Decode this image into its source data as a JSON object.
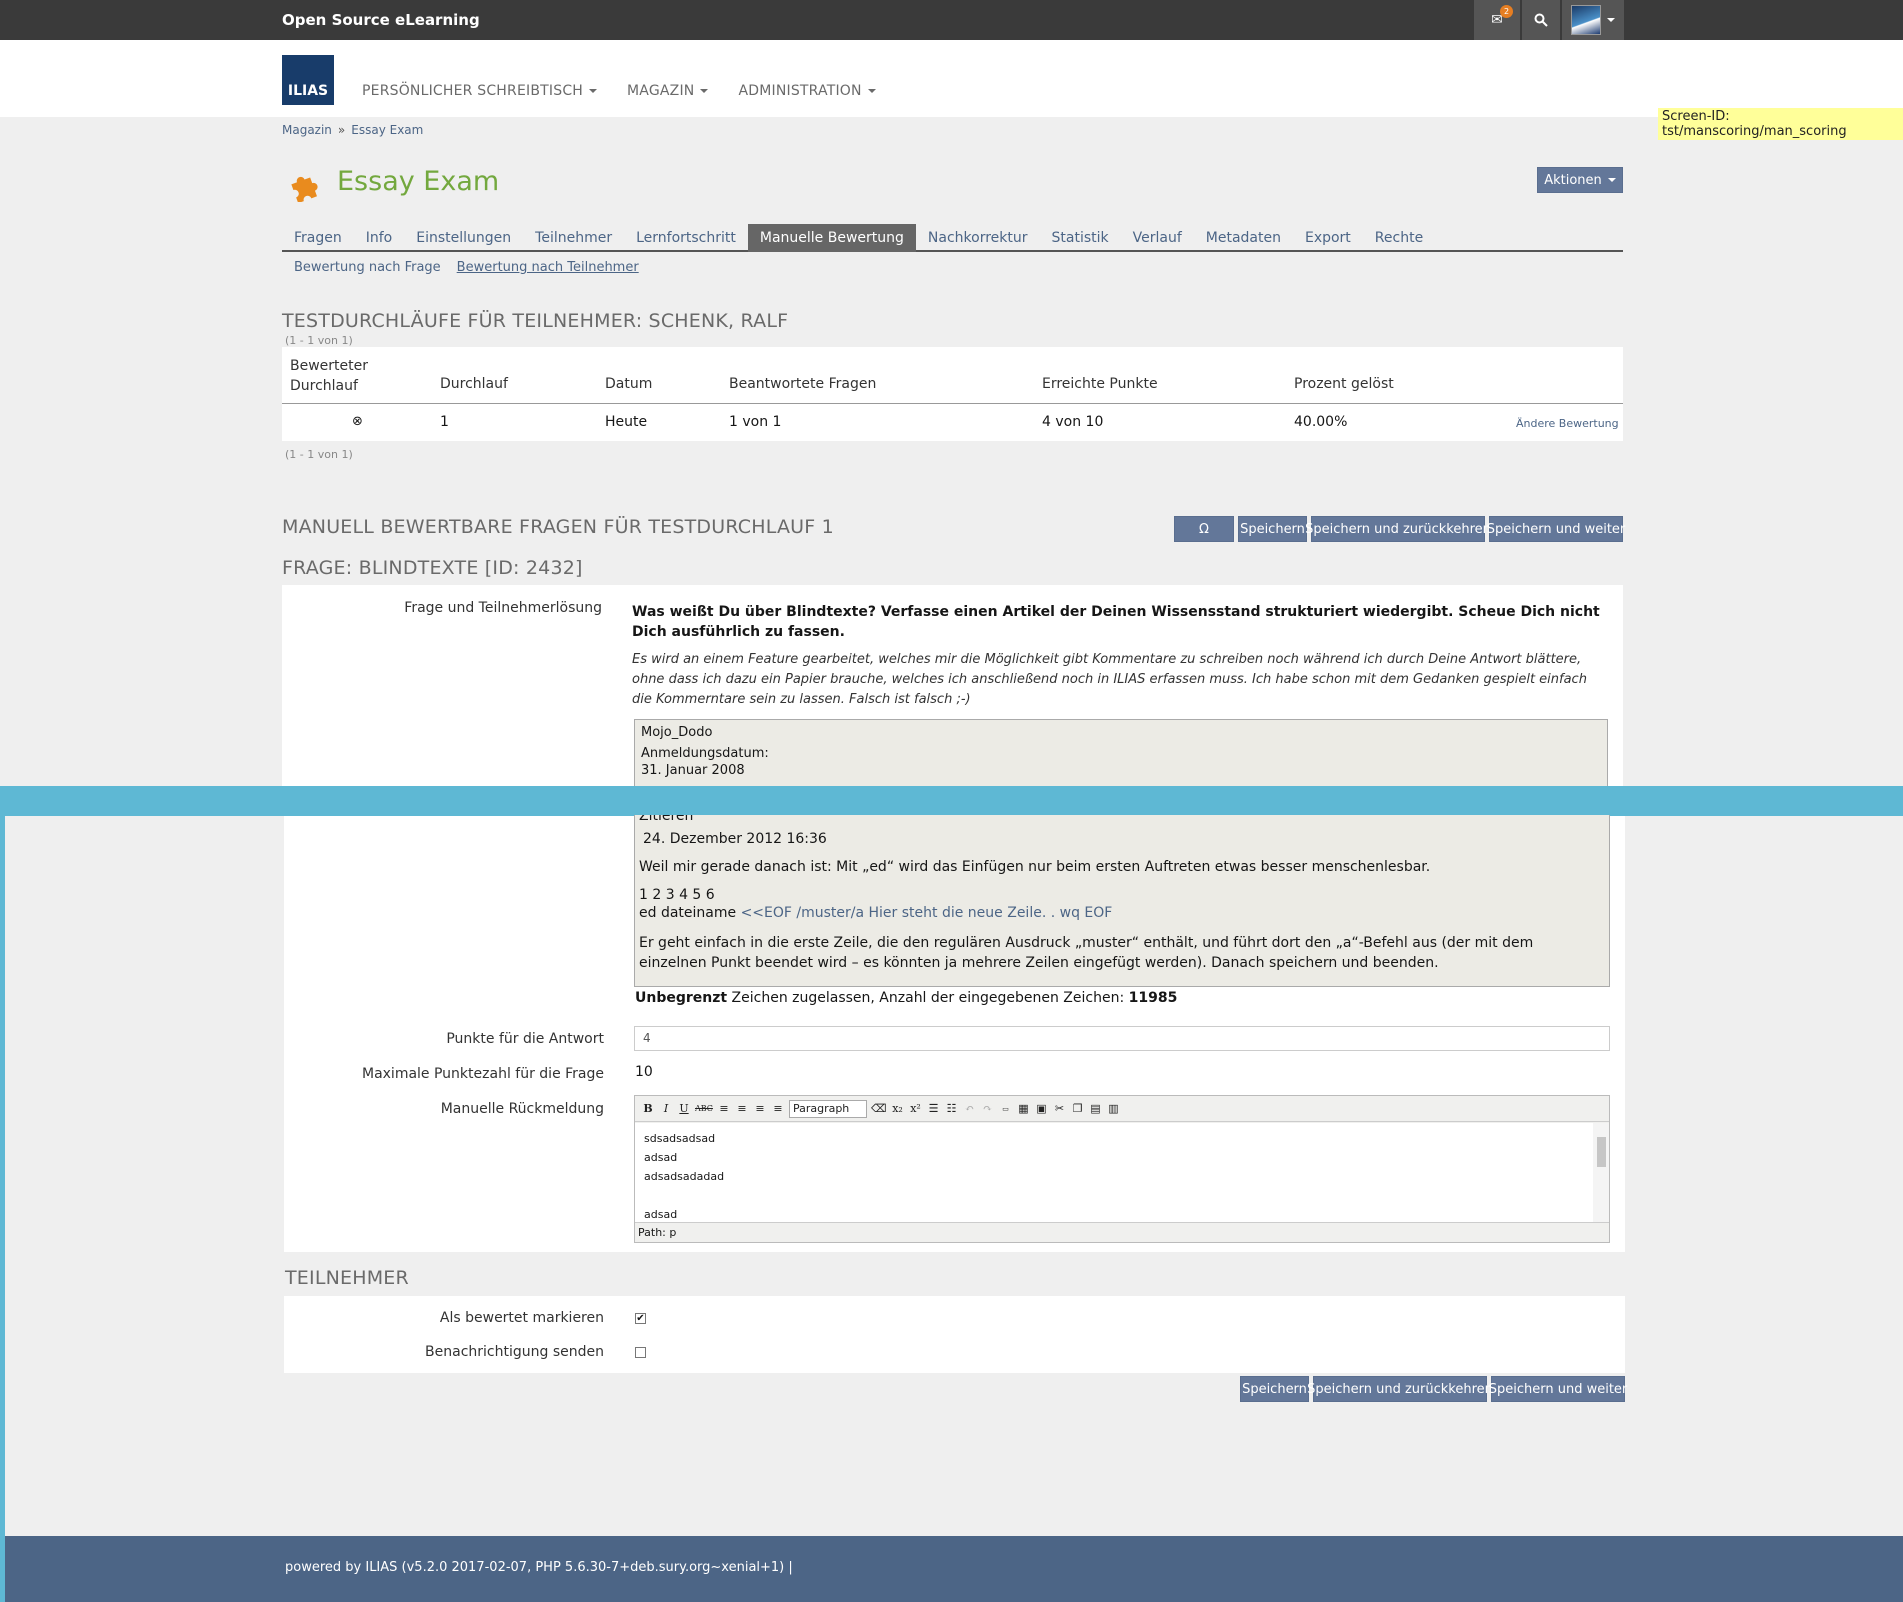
{
  "topbar": {
    "brand": "Open Source eLearning",
    "mail_count": "2"
  },
  "header": {
    "logo": "ILIAS",
    "nav": [
      "PERSÖNLICHER SCHREIBTISCH",
      "MAGAZIN",
      "ADMINISTRATION"
    ]
  },
  "screen_id": "Screen-ID: tst/manscoring/man_scoring",
  "breadcrumbs": [
    "Magazin",
    "Essay Exam"
  ],
  "page_title": "Essay Exam",
  "actions_label": "Aktionen",
  "tabs": [
    "Fragen",
    "Info",
    "Einstellungen",
    "Teilnehmer",
    "Lernfortschritt",
    "Manuelle Bewertung",
    "Nachkorrektur",
    "Statistik",
    "Verlauf",
    "Metadaten",
    "Export",
    "Rechte"
  ],
  "active_tab": "Manuelle Bewertung",
  "subtabs": [
    "Bewertung nach Frage",
    "Bewertung nach Teilnehmer"
  ],
  "runs": {
    "heading": "Testdurchläufe für Teilnehmer: Schenk, Ralf",
    "count_top": "(1 - 1 von 1)",
    "count_bottom": "(1 - 1 von 1)",
    "headers": {
      "bewertet_1": "Bewerteter",
      "bewertet_2": "Durchlauf",
      "durchlauf": "Durchlauf",
      "datum": "Datum",
      "beantwortet": "Beantwortete Fragen",
      "punkte": "Erreichte Punkte",
      "prozent": "Prozent gelöst"
    },
    "row": {
      "marker": "⊗",
      "durchlauf": "1",
      "datum": "Heute",
      "beantwortet": "1 von 1",
      "punkte": "4 von 10",
      "prozent": "40.00%",
      "action": "Ändere Bewertung"
    }
  },
  "manual": {
    "heading": "Manuell bewertbare Fragen für Testdurchlauf 1",
    "omega": "Ω",
    "save": "Speichern",
    "save_return": "Speichern und zurückkehren",
    "save_next": "Speichern und weiter",
    "question_heading": "Frage: Blindtexte [ID: 2432]"
  },
  "form": {
    "label_question": "Frage und Teilnehmerlösung",
    "question_text": "Was weißt Du über Blindtexte? Verfasse einen Artikel der Deinen Wissensstand strukturiert wiedergibt. Scheue Dich nicht Dich ausführlich zu fassen.",
    "question_hint": "Es wird an einem Feature gearbeitet, welches mir die Möglichkeit gibt Kommentare zu schreiben noch während ich durch Deine Antwort blättere, ohne dass ich dazu ein Papier brauche, welches ich anschließend noch in ILIAS erfassen muss. Ich habe schon mit dem Gedanken gespielt einfach die Kommerntare sein zu lassen. Falsch ist falsch ;-)",
    "answer_top": {
      "user": "Mojo_Dodo",
      "reg_label": "Anmeldungsdatum:",
      "reg_date": "31. Januar 2008"
    },
    "answer_bottom": {
      "quote": "Zitieren",
      "date": "24. Dezember 2012 16:36",
      "p1": "Weil mir gerade danach ist: Mit „ed“ wird das Einfügen nur beim ersten Auftreten etwas besser menschenlesbar.",
      "p2": "1 2 3 4 5 6",
      "p3a": "ed dateiname ",
      "p3b": "<<EOF /muster/a Hier steht die neue Zeile. . wq EOF",
      "p4": "Er geht einfach in die erste Zeile, die den regulären Ausdruck „muster“ enthält, und führt dort den „a“-Befehl aus (der mit dem einzelnen Punkt beendet wird – es könnten ja mehrere Zeilen eingefügt werden). Danach speichern und beenden."
    },
    "chars_a": "Unbegrenzt",
    "chars_b": " Zeichen zugelassen, Anzahl der eingegebenen Zeichen: ",
    "chars_c": "11985",
    "label_points": "Punkte für die Antwort",
    "points_value": "4",
    "label_max": "Maximale Punktezahl für die Frage",
    "max_value": "10",
    "label_feedback": "Manuelle Rückmeldung",
    "editor_format": "Paragraph",
    "editor_lines": [
      "sdsadsadsad",
      "adsad",
      "adsadsadadad",
      "",
      "adsad"
    ],
    "editor_path": "Path: p"
  },
  "participant": {
    "heading": "Teilnehmer",
    "label_scored": "Als bewertet markieren",
    "label_notify": "Benachrichtigung senden",
    "scored": true,
    "notify": false
  },
  "footer": "powered by ILIAS (v5.2.0 2017-02-07, PHP 5.6.30-7+deb.sury.org~xenial+1) |"
}
